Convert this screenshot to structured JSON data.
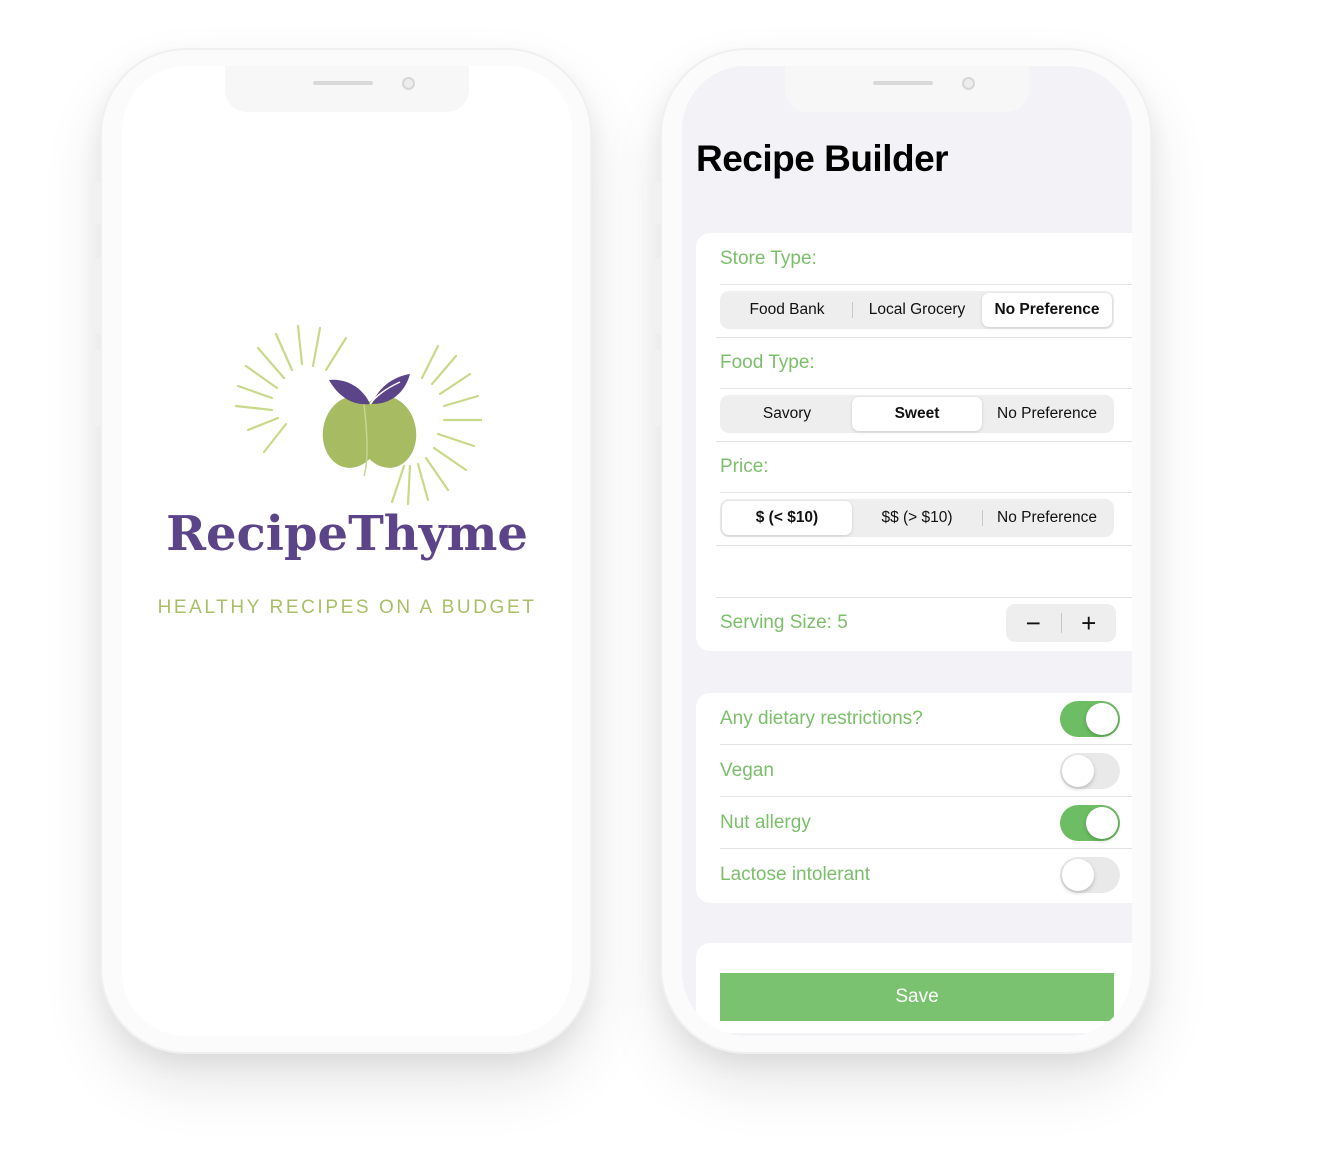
{
  "splash": {
    "brand_name": "RecipeThyme",
    "tagline": "HEALTHY RECIPES ON A BUDGET",
    "colors": {
      "brand_purple": "#5c4489",
      "brand_green": "#a8bf68"
    }
  },
  "builder": {
    "title": "Recipe Builder",
    "store_type": {
      "label": "Store Type:",
      "options": [
        "Food Bank",
        "Local Grocery",
        "No Preference"
      ],
      "selected": "No Preference"
    },
    "food_type": {
      "label": "Food Type:",
      "options": [
        "Savory",
        "Sweet",
        "No Preference"
      ],
      "selected": "Sweet"
    },
    "price": {
      "label": "Price:",
      "options": [
        "$ (< $10)",
        "$$ (> $10)",
        "No Preference"
      ],
      "selected": "$ (< $10)"
    },
    "serving": {
      "label": "Serving Size: 5",
      "decrement": "−",
      "increment": "+"
    },
    "toggles": [
      {
        "label": "Any dietary restrictions?",
        "on": true
      },
      {
        "label": "Vegan",
        "on": false
      },
      {
        "label": "Nut allergy",
        "on": true
      },
      {
        "label": "Lactose intolerant",
        "on": false
      }
    ],
    "save_label": "Save",
    "colors": {
      "accent_green": "#7bbf6a",
      "toggle_on": "#6cbd63",
      "button": "#7ac270"
    }
  }
}
